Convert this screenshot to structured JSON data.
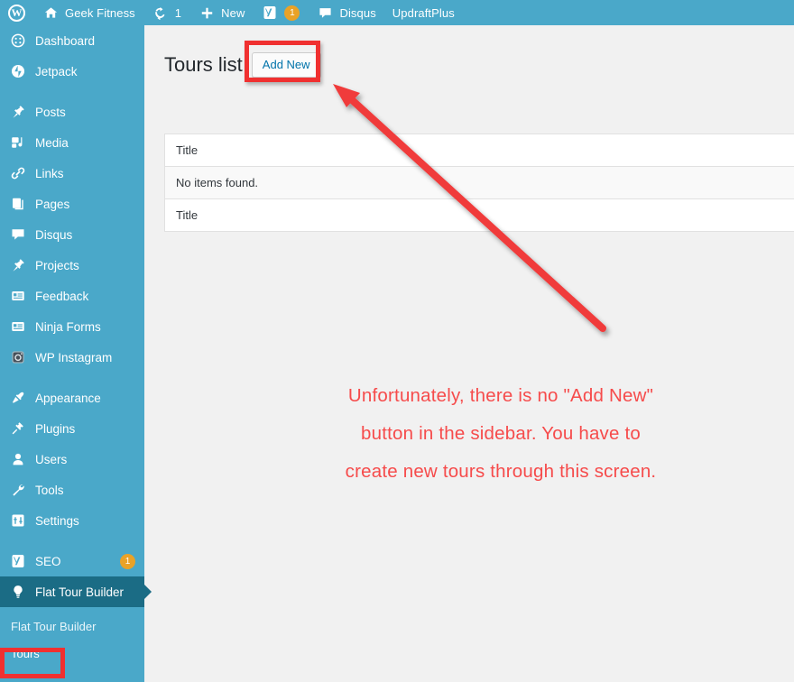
{
  "colors": {
    "adminbar_bg": "#4aa8c9",
    "sidebar_bg": "#4aa8c9",
    "sidebar_active_bg": "#1b6c85",
    "content_bg": "#f1f1f1",
    "highlight_red": "#f03030",
    "annotation_red": "#f64b4b",
    "badge_orange": "#e9a227",
    "link_blue": "#0073aa"
  },
  "adminbar": {
    "items": [
      {
        "icon": "wordpress-logo-icon",
        "label": ""
      },
      {
        "icon": "home-icon",
        "label": "Geek Fitness"
      },
      {
        "icon": "updates-icon",
        "label": "1"
      },
      {
        "icon": "plus-icon",
        "label": "New"
      },
      {
        "icon": "yoast-icon",
        "label": "",
        "badge": "1"
      },
      {
        "icon": "comment-icon",
        "label": "Disqus"
      },
      {
        "icon": "",
        "label": "UpdraftPlus"
      }
    ]
  },
  "sidebar": {
    "items": [
      {
        "icon": "dashboard-icon",
        "label": "Dashboard",
        "gap": false,
        "active": false
      },
      {
        "icon": "jetpack-icon",
        "label": "Jetpack",
        "gap": false,
        "active": false
      },
      {
        "icon": "pin-icon",
        "label": "Posts",
        "gap": true,
        "active": false
      },
      {
        "icon": "media-icon",
        "label": "Media",
        "gap": false,
        "active": false
      },
      {
        "icon": "link-icon",
        "label": "Links",
        "gap": false,
        "active": false
      },
      {
        "icon": "pages-icon",
        "label": "Pages",
        "gap": false,
        "active": false
      },
      {
        "icon": "comment-icon",
        "label": "Disqus",
        "gap": false,
        "active": false
      },
      {
        "icon": "pin-icon",
        "label": "Projects",
        "gap": false,
        "active": false
      },
      {
        "icon": "feedback-icon",
        "label": "Feedback",
        "gap": false,
        "active": false
      },
      {
        "icon": "forms-icon",
        "label": "Ninja Forms",
        "gap": false,
        "active": false
      },
      {
        "icon": "instagram-icon",
        "label": "WP Instagram",
        "gap": false,
        "active": false
      },
      {
        "icon": "appearance-icon",
        "label": "Appearance",
        "gap": true,
        "active": false
      },
      {
        "icon": "plugins-icon",
        "label": "Plugins",
        "gap": false,
        "active": false
      },
      {
        "icon": "users-icon",
        "label": "Users",
        "gap": false,
        "active": false
      },
      {
        "icon": "tools-icon",
        "label": "Tools",
        "gap": false,
        "active": false
      },
      {
        "icon": "settings-icon",
        "label": "Settings",
        "gap": false,
        "active": false
      },
      {
        "icon": "yoast-icon",
        "label": "SEO",
        "gap": true,
        "active": false,
        "badge": "1"
      },
      {
        "icon": "lightbulb-icon",
        "label": "Flat Tour Builder",
        "gap": false,
        "active": true
      }
    ],
    "submenu": [
      {
        "label": "Flat Tour Builder",
        "current": false
      },
      {
        "label": "Tours",
        "current": true
      }
    ]
  },
  "page": {
    "title": "Tours list",
    "add_new_label": "Add New"
  },
  "table": {
    "header": "Title",
    "empty_message": "No items found.",
    "footer": "Title"
  },
  "annotation": {
    "lines": [
      "Unfortunately, there is no \"Add New\"",
      "button in the sidebar. You have to",
      "create new tours through this screen."
    ]
  }
}
